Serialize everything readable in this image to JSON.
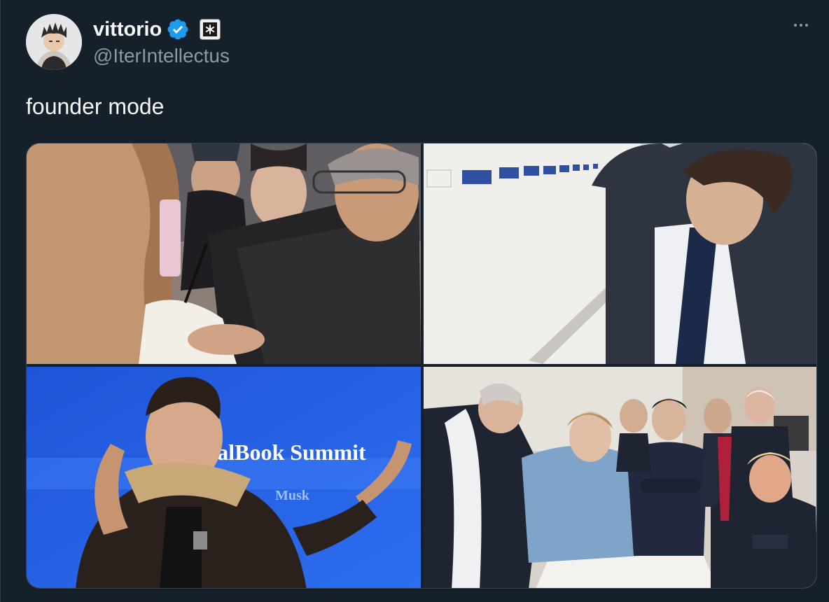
{
  "user": {
    "display_name": "vittorio",
    "handle": "@IterIntellectus",
    "verified": true,
    "verified_color": "#1d9bf0"
  },
  "tweet": {
    "text": "founder mode"
  },
  "media": {
    "banner_text": "ealBook Summit",
    "banner_subtext": "Musk"
  },
  "icons": {
    "more": "more-horizontal-icon",
    "verified": "verified-badge-icon",
    "affiliate": "affiliate-badge-icon"
  },
  "colors": {
    "background": "#15202b",
    "text_primary": "#f7f9f9",
    "text_secondary": "#8b98a5",
    "border": "#38444d",
    "accent": "#1d9bf0"
  }
}
